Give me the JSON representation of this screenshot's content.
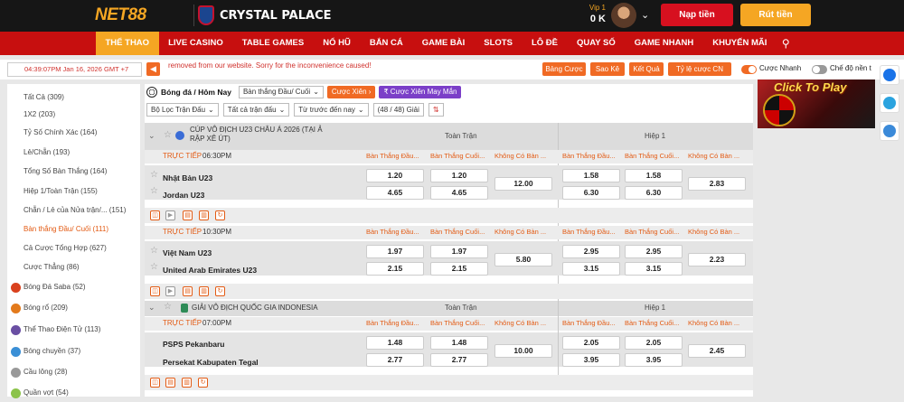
{
  "header": {
    "logo_text": "NET88",
    "club_name": "CRYSTAL PALACE",
    "vip_label": "Vip 1",
    "balance": "0 K",
    "deposit_label": "Nạp tiền",
    "withdraw_label": "Rút tiền"
  },
  "nav": {
    "items": [
      "THỂ THAO",
      "LIVE CASINO",
      "TABLE GAMES",
      "NỔ HŨ",
      "BẮN CÁ",
      "GAME BÀI",
      "SLOTS",
      "LÔ ĐỀ",
      "QUAY SỐ",
      "GAME NHANH",
      "KHUYẾN MÃI"
    ],
    "active_index": 0
  },
  "ticker": {
    "datetime": "04:39:07PM Jan 16, 2026 GMT +7",
    "message": "removed from our website. Sorry for the inconvenience caused!",
    "buttons": [
      "Bảng Cược",
      "Sao Kê",
      "Kết Quả",
      "Tỷ lệ cược CN"
    ],
    "quick_bet_label": "Cược Nhanh",
    "dark_mode_label": "Chế độ nền t"
  },
  "sidebar": {
    "sub_items": [
      {
        "label": "Tất Cả (309)"
      },
      {
        "label": "1X2 (203)"
      },
      {
        "label": "Tỷ Số Chính Xác (164)"
      },
      {
        "label": "Lẻ/Chẵn (193)"
      },
      {
        "label": "Tổng Số Bàn Thắng (164)"
      },
      {
        "label": "Hiệp 1/Toàn Trận (155)"
      },
      {
        "label": "Chẵn / Lẻ của Nửa trận/...   (151)"
      },
      {
        "label": "Bàn thắng Đầu/ Cuối (111)"
      },
      {
        "label": "Cả Cược Tổng Hợp (627)"
      },
      {
        "label": "Cược Thẳng (86)"
      }
    ],
    "selected_index": 7,
    "categories": [
      {
        "label": "Bóng Đá Saba",
        "count": "(52)",
        "color": "#d9411e"
      },
      {
        "label": "Bóng rổ",
        "count": "(209)",
        "color": "#e37a1c"
      },
      {
        "label": "Thể Thao Điện Tử",
        "count": "(113)",
        "color": "#6a4fa3"
      },
      {
        "label": "Bóng chuyền",
        "count": "(37)",
        "color": "#3a8fd6"
      },
      {
        "label": "Cầu lông",
        "count": "(28)",
        "color": "#999999"
      },
      {
        "label": "Quần vợt",
        "count": "(54)",
        "color": "#8bc34a"
      }
    ]
  },
  "filters": {
    "breadcrumb": "Bóng đá / Hôm Nay",
    "market_dropdown": "Bàn thắng Đầu/ Cuối",
    "parlay_label": "Cược Xiên",
    "lucky_parlay_label": "Cược Xiên May Mắn",
    "league_filter": "Bộ Lọc Trận Đấu",
    "all_matches": "Tất cả trận đấu",
    "sort_label": "Từ trước đến nay",
    "league_count": "(48 / 48) Giải"
  },
  "markets": {
    "full_time": "Toàn Trận",
    "half_1": "Hiệp 1",
    "first_goal": "Bàn Thắng Đầu...",
    "last_goal": "Bàn Thắng Cuối...",
    "no_goal": "Không Có Bàn ..."
  },
  "leagues": [
    {
      "name": "CÚP VÔ ĐỊCH U23 CHÂU Á 2026 (TẠI Ả RẬP XÊ ÚT)",
      "matches": [
        {
          "status": "TRỰC TIẾP",
          "time": "06:30PM",
          "home": "Nhật Bản U23",
          "away": "Jordan U23",
          "ft_first": [
            "1.20",
            "4.65"
          ],
          "ft_last": [
            "1.20",
            "4.65"
          ],
          "ft_none": "12.00",
          "h1_first": [
            "1.58",
            "6.30"
          ],
          "h1_last": [
            "1.58",
            "6.30"
          ],
          "h1_none": "2.83"
        },
        {
          "status": "TRỰC TIẾP",
          "time": "10:30PM",
          "home": "Việt Nam U23",
          "away": "United Arab Emirates U23",
          "ft_first": [
            "1.97",
            "2.15"
          ],
          "ft_last": [
            "1.97",
            "2.15"
          ],
          "ft_none": "5.80",
          "h1_first": [
            "2.95",
            "3.15"
          ],
          "h1_last": [
            "2.95",
            "3.15"
          ],
          "h1_none": "2.23"
        }
      ]
    },
    {
      "name": "GIẢI VÔ ĐỊCH QUỐC GIA INDONESIA",
      "matches": [
        {
          "status": "TRỰC TIẾP",
          "time": "07:00PM",
          "home": "PSPS Pekanbaru",
          "away": "Persekat Kabupaten Tegal",
          "ft_first": [
            "1.48",
            "2.77"
          ],
          "ft_last": [
            "1.48",
            "2.77"
          ],
          "ft_none": "10.00",
          "h1_first": [
            "2.05",
            "3.95"
          ],
          "h1_last": [
            "2.05",
            "3.95"
          ],
          "h1_none": "2.45"
        }
      ]
    }
  ],
  "banner": {
    "text": "Click To Play"
  }
}
